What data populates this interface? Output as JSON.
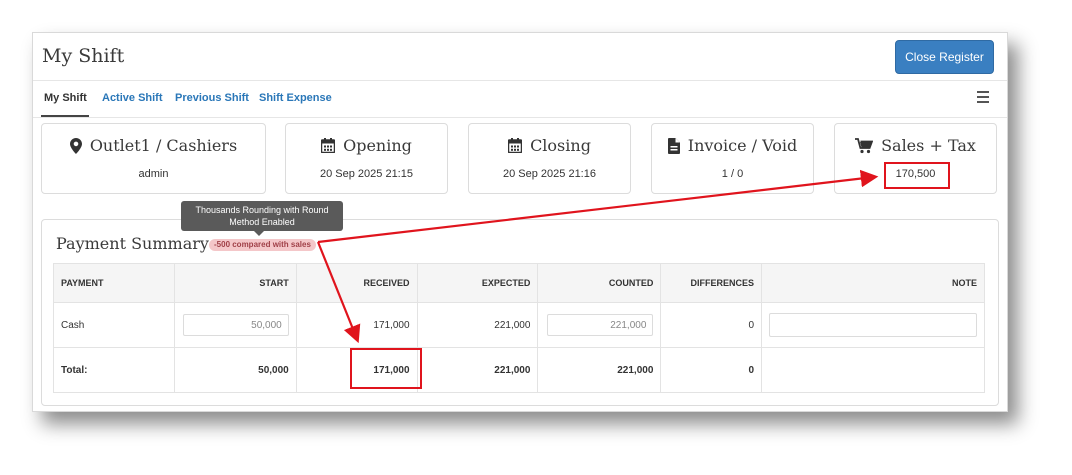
{
  "header": {
    "title": "My Shift",
    "close_register_label": "Close Register"
  },
  "tabs": [
    {
      "label": "My Shift",
      "active": true
    },
    {
      "label": "Active Shift"
    },
    {
      "label": "Previous Shift"
    },
    {
      "label": "Shift Expense"
    }
  ],
  "cards": [
    {
      "title": "Outlet1 / Cashiers",
      "value": "admin",
      "icon": "location-pin-icon"
    },
    {
      "title": "Opening",
      "value": "20 Sep 2025 21:15",
      "icon": "calendar-icon"
    },
    {
      "title": "Closing",
      "value": "20 Sep 2025 21:16",
      "icon": "calendar-icon"
    },
    {
      "title": "Invoice / Void",
      "value": "1 / 0",
      "icon": "file-icon"
    },
    {
      "title": "Sales + Tax",
      "value": "170,500",
      "icon": "cart-icon"
    }
  ],
  "summary": {
    "title": "Payment Summary",
    "badge": "-500 compared with sales",
    "tooltip": "Thousands Rounding with Round Method Enabled"
  },
  "table": {
    "headers": [
      "PAYMENT",
      "START",
      "RECEIVED",
      "EXPECTED",
      "COUNTED",
      "DIFFERENCES",
      "NOTE"
    ],
    "rows": [
      {
        "payment": "Cash",
        "start": "50,000",
        "received": "171,000",
        "expected": "221,000",
        "counted": "221,000",
        "differences": "0",
        "note": ""
      }
    ],
    "total": {
      "label": "Total:",
      "start": "50,000",
      "received": "171,000",
      "expected": "221,000",
      "counted": "221,000",
      "differences": "0"
    }
  },
  "colors": {
    "accent": "#3a7fc1",
    "link": "#2a77b8",
    "highlight": "#e0141d",
    "badge_bg": "#f4c7c9"
  }
}
